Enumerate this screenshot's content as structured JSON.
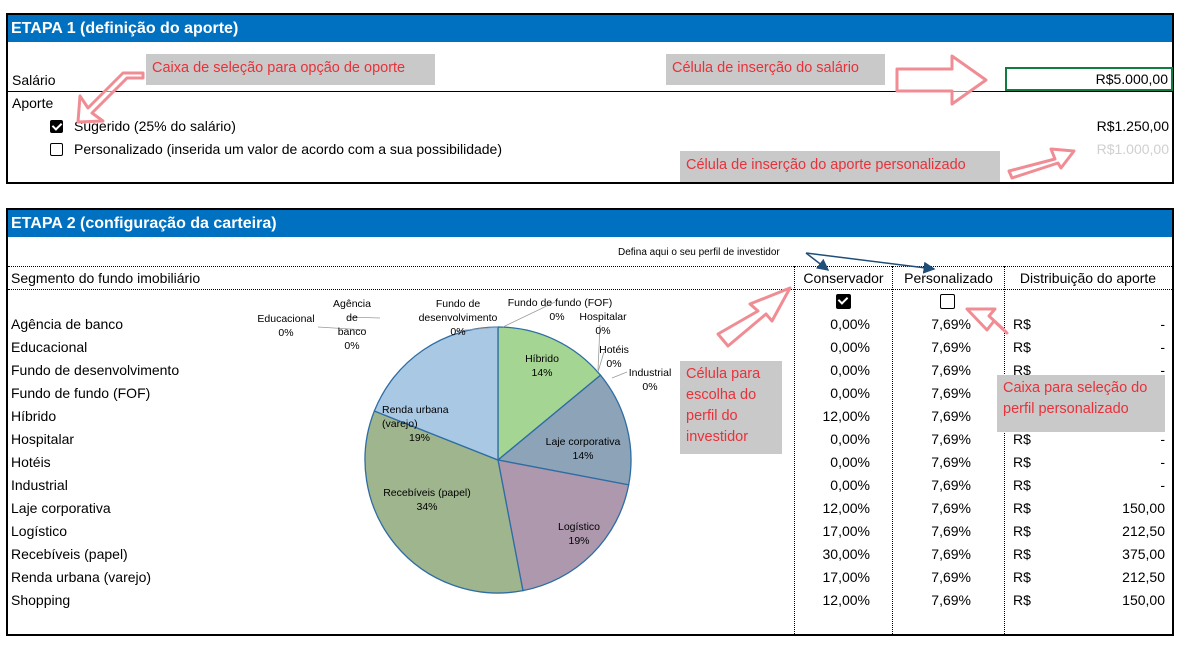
{
  "etapa1": {
    "title": "ETAPA 1 (definição do aporte)",
    "salario_label": "Salário",
    "salario_value": "R$5.000,00",
    "aporte_label": "Aporte",
    "sugerido_label": "Sugerido (25% do salário)",
    "sugerido_value": "R$1.250,00",
    "sugerido_checked": true,
    "personalizado_label": "Personalizado (inserida um valor de acordo com a sua possibilidade)",
    "personalizado_value": "R$1.000,00",
    "personalizado_checked": false,
    "notes": {
      "caixa_selecao": "Caixa de seleção para opção de oporte",
      "celula_salario": "Célula de inserção do salário",
      "celula_aporte": "Célula de inserção do aporte personalizado"
    }
  },
  "etapa2": {
    "title": "ETAPA 2 (configuração da carteira)",
    "perfil_hint": "Defina aqui o seu perfil de investidor",
    "headers": {
      "segmento": "Segmento do fundo imobiliário",
      "conservador": "Conservador",
      "personalizado": "Personalizado",
      "distribuicao": "Distribuição do aporte"
    },
    "conservador_checked": true,
    "personalizado_checked": false,
    "rows": [
      {
        "seg": "Agência de banco",
        "cons": "0,00%",
        "pers": "7,69%",
        "cur": "R$",
        "dist": "-"
      },
      {
        "seg": "Educacional",
        "cons": "0,00%",
        "pers": "7,69%",
        "cur": "R$",
        "dist": "-"
      },
      {
        "seg": "Fundo de desenvolvimento",
        "cons": "0,00%",
        "pers": "7,69%",
        "cur": "R$",
        "dist": "-"
      },
      {
        "seg": "Fundo de fundo (FOF)",
        "cons": "0,00%",
        "pers": "7,69%",
        "cur": "R$",
        "dist": "-"
      },
      {
        "seg": "Híbrido",
        "cons": "12,00%",
        "pers": "7,69%",
        "cur": "R$",
        "dist": "-"
      },
      {
        "seg": "Hospitalar",
        "cons": "0,00%",
        "pers": "7,69%",
        "cur": "R$",
        "dist": "-"
      },
      {
        "seg": "Hotéis",
        "cons": "0,00%",
        "pers": "7,69%",
        "cur": "R$",
        "dist": "-"
      },
      {
        "seg": "Industrial",
        "cons": "0,00%",
        "pers": "7,69%",
        "cur": "R$",
        "dist": "-"
      },
      {
        "seg": "Laje corporativa",
        "cons": "12,00%",
        "pers": "7,69%",
        "cur": "R$",
        "dist": "150,00"
      },
      {
        "seg": "Logístico",
        "cons": "17,00%",
        "pers": "7,69%",
        "cur": "R$",
        "dist": "212,50"
      },
      {
        "seg": "Recebíveis (papel)",
        "cons": "30,00%",
        "pers": "7,69%",
        "cur": "R$",
        "dist": "375,00"
      },
      {
        "seg": "Renda urbana (varejo)",
        "cons": "17,00%",
        "pers": "7,69%",
        "cur": "R$",
        "dist": "212,50"
      },
      {
        "seg": "Shopping",
        "cons": "12,00%",
        "pers": "7,69%",
        "cur": "R$",
        "dist": "150,00"
      }
    ],
    "notes": {
      "celula_perfil": "Célula para escolha do perfil do investidor",
      "caixa_perfil": "Caixa para seleção do perfil personalizado"
    }
  },
  "chart_data": {
    "type": "pie",
    "slices": [
      {
        "name": "Agência de banco",
        "pct": "0%",
        "value": 0,
        "color": "#4a86c5"
      },
      {
        "name": "Educacional",
        "pct": "0%",
        "value": 0,
        "color": "#4a86c5"
      },
      {
        "name": "Fundo de desenvolvimento",
        "pct": "0%",
        "value": 0,
        "color": "#4a86c5"
      },
      {
        "name": "Fundo de fundo (FOF)",
        "pct": "0%",
        "value": 0,
        "color": "#4a86c5"
      },
      {
        "name": "Híbrido",
        "pct": "14%",
        "value": 14,
        "color": "#a5d593"
      },
      {
        "name": "Hospitalar",
        "pct": "0%",
        "value": 0,
        "color": "#a5d593"
      },
      {
        "name": "Hotéis",
        "pct": "0%",
        "value": 0,
        "color": "#a5d593"
      },
      {
        "name": "Industrial",
        "pct": "0%",
        "value": 0,
        "color": "#a5d593"
      },
      {
        "name": "Laje corporativa",
        "pct": "14%",
        "value": 14,
        "color": "#8ca3b8"
      },
      {
        "name": "Logístico",
        "pct": "19%",
        "value": 19,
        "color": "#ae98ae"
      },
      {
        "name": "Recebíveis (papel)",
        "pct": "34%",
        "value": 34,
        "color": "#9fb58e"
      },
      {
        "name": "Renda urbana (varejo)",
        "pct": "19%",
        "value": 19,
        "color": "#a9c8e4"
      }
    ],
    "labels": {
      "educacional": [
        "Educacional",
        "0%"
      ],
      "agencia": [
        "Agência",
        "de",
        "banco",
        "0%"
      ],
      "fundo_dev": [
        "Fundo de",
        "desenvolvimento",
        "0%"
      ],
      "fof": [
        "Fundo de fundo (FOF)",
        "0%"
      ],
      "hospitalar": [
        "Hospitalar",
        "0%"
      ],
      "hoteis": [
        "Hotéis",
        "0%"
      ],
      "industrial": [
        "Industrial",
        "0%"
      ],
      "hibrido": [
        "Híbrido",
        "14%"
      ],
      "laje": [
        "Laje corporativa",
        "14%"
      ],
      "logistico": [
        "Logístico",
        "19%"
      ],
      "recebiveis": [
        "Recebíveis (papel)",
        "34%"
      ],
      "renda": [
        "Renda urbana",
        "(varejo)",
        "19%"
      ]
    }
  }
}
